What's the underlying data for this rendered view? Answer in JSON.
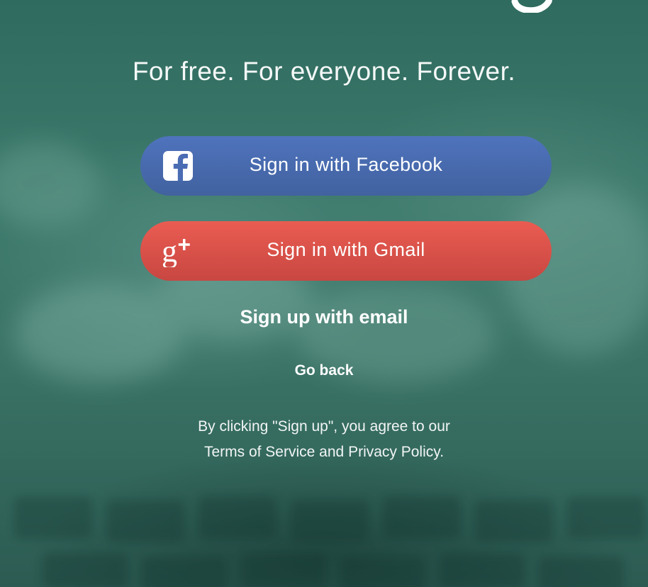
{
  "tagline": "For free. For everyone. Forever.",
  "buttons": {
    "facebook": {
      "label": "Sign in with Facebook",
      "icon": "facebook-icon",
      "color": "#4a6cb3"
    },
    "gmail": {
      "label": "Sign in with Gmail",
      "icon": "google-plus-icon",
      "color": "#e0524b"
    }
  },
  "links": {
    "signup_email": "Sign up with email",
    "go_back": "Go back"
  },
  "legal": {
    "line1": "By clicking \"Sign up\", you agree to our",
    "terms": "Terms of Service",
    "and": "and",
    "privacy": "Privacy Policy",
    "period": "."
  },
  "colors": {
    "background": "#35705f",
    "text": "#ffffff"
  }
}
